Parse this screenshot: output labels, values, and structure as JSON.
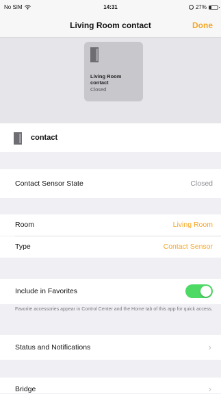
{
  "status_bar": {
    "carrier": "No SIM",
    "time": "14:31",
    "battery": "27%"
  },
  "nav": {
    "title": "Living Room contact",
    "done_label": "Done"
  },
  "tile": {
    "name": "Living Room contact",
    "state": "Closed"
  },
  "device": {
    "name": "contact"
  },
  "sensor": {
    "label": "Contact Sensor State",
    "value": "Closed"
  },
  "room": {
    "label": "Room",
    "value": "Living Room"
  },
  "type": {
    "label": "Type",
    "value": "Contact Sensor"
  },
  "favorites": {
    "label": "Include in Favorites",
    "enabled": true,
    "footnote": "Favorite accessories appear in Control Center and the Home tab of this app for quick access."
  },
  "status_notifications": {
    "label": "Status and Notifications"
  },
  "bridge": {
    "label": "Bridge"
  },
  "colors": {
    "accent": "#f5a623",
    "toggle_on": "#4cd964",
    "background": "#efeff4"
  },
  "icons": {
    "wifi": "wifi-icon",
    "alarm": "alarm-icon",
    "battery": "battery-icon",
    "contact_sensor": "contact-sensor-icon",
    "chevron": "chevron-right-icon"
  }
}
